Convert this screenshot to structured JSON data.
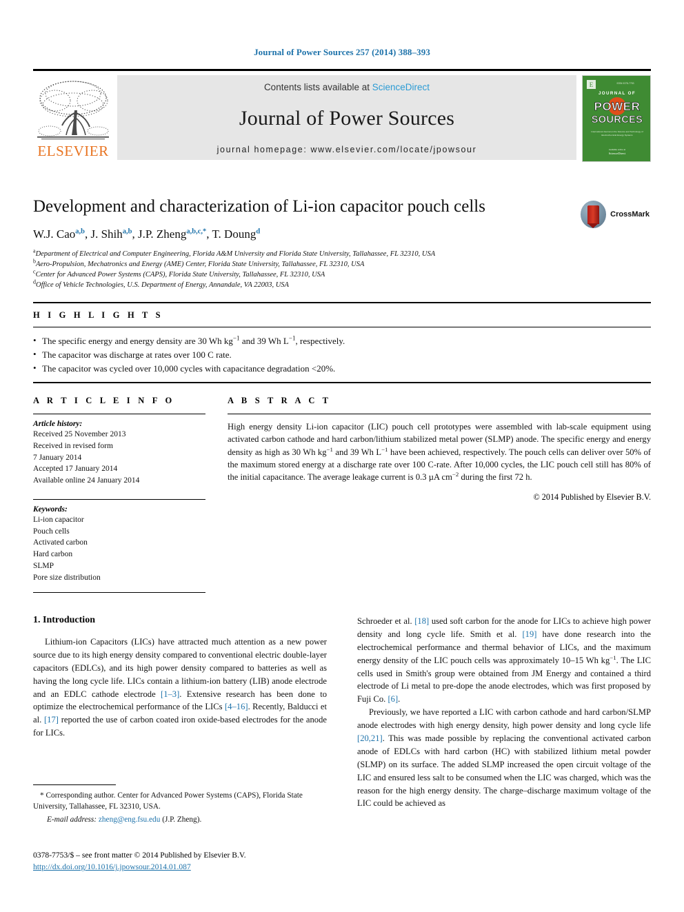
{
  "running_head": "Journal of Power Sources 257 (2014) 388–393",
  "masthead": {
    "publisher_name": "ELSEVIER",
    "publisher_logo_alt": "elsevier-tree-logo",
    "contents_prefix": "Contents lists available at ",
    "contents_link": "ScienceDirect",
    "journal_name": "Journal of Power Sources",
    "homepage": "journal homepage: www.elsevier.com/locate/jpowsour",
    "cover": {
      "line1": "JOURNAL OF",
      "line2": "POWER",
      "line3": "SOURCES",
      "tagline": "International Journal on the Science and Technology of Electrochemical Energy Systems",
      "footer": "Available online at ScienceDirect",
      "bg_color": "#3f8b33",
      "accent_color": "#e04e1b"
    }
  },
  "article": {
    "title": "Development and characterization of Li-ion capacitor pouch cells",
    "authors": [
      {
        "name": "W.J. Cao",
        "marks": "a,b"
      },
      {
        "name": "J. Shih",
        "marks": "a,b"
      },
      {
        "name": "J.P. Zheng",
        "marks": "a,b,c,*"
      },
      {
        "name": "T. Doung",
        "marks": "d"
      }
    ],
    "affiliations": [
      {
        "mark": "a",
        "text": "Department of Electrical and Computer Engineering, Florida A&M University and Florida State University, Tallahassee, FL 32310, USA"
      },
      {
        "mark": "b",
        "text": "Aero-Propulsion, Mechatronics and Energy (AME) Center, Florida State University, Tallahassee, FL 32310, USA"
      },
      {
        "mark": "c",
        "text": "Center for Advanced Power Systems (CAPS), Florida State University, Tallahassee, FL 32310, USA"
      },
      {
        "mark": "d",
        "text": "Office of Vehicle Technologies, U.S. Department of Energy, Annandale, VA 22003, USA"
      }
    ],
    "crossmark_label": "CrossMark"
  },
  "highlights": {
    "label": "H I G H L I G H T S",
    "items": [
      "The specific energy and energy density are 30 Wh kg−1 and 39 Wh L−1, respectively.",
      "The capacitor was discharge at rates over 100 C rate.",
      "The capacitor was cycled over 10,000 cycles with capacitance degradation <20%."
    ]
  },
  "article_info": {
    "label": "A R T I C L E  I N F O",
    "history_title": "Article history:",
    "history": [
      "Received 25 November 2013",
      "Received in revised form",
      "7 January 2014",
      "Accepted 17 January 2014",
      "Available online 24 January 2014"
    ],
    "keywords_title": "Keywords:",
    "keywords": [
      "Li-ion capacitor",
      "Pouch cells",
      "Activated carbon",
      "Hard carbon",
      "SLMP",
      "Pore size distribution"
    ]
  },
  "abstract": {
    "label": "A B S T R A C T",
    "text": "High energy density Li-ion capacitor (LIC) pouch cell prototypes were assembled with lab-scale equipment using activated carbon cathode and hard carbon/lithium stabilized metal power (SLMP) anode. The specific energy and energy density as high as 30 Wh kg−1 and 39 Wh L−1 have been achieved, respectively. The pouch cells can deliver over 50% of the maximum stored energy at a discharge rate over 100 C-rate. After 10,000 cycles, the LIC pouch cell still has 80% of the initial capacitance. The average leakage current is 0.3 µA cm−2 during the first 72 h.",
    "copyright": "© 2014 Published by Elsevier B.V."
  },
  "body": {
    "section_heading": "1.  Introduction",
    "left_paragraphs": [
      "Lithium-ion Capacitors (LICs) have attracted much attention as a new power source due to its high energy density compared to conventional electric double-layer capacitors (EDLCs), and its high power density compared to batteries as well as having the long cycle life. LICs contain a lithium-ion battery (LIB) anode electrode and an EDLC cathode electrode [1–3]. Extensive research has been done to optimize the electrochemical performance of the LICs [4–16]. Recently, Balducci et al. [17] reported the use of carbon coated iron oxide-based electrodes for the anode for LICs."
    ],
    "right_paragraphs": [
      "Schroeder et al. [18] used soft carbon for the anode for LICs to achieve high power density and long cycle life. Smith et al. [19] have done research into the electrochemical performance and thermal behavior of LICs, and the maximum energy density of the LIC pouch cells was approximately 10–15 Wh kg−1. The LIC cells used in Smith's group were obtained from JM Energy and contained a third electrode of Li metal to pre-dope the anode electrodes, which was first proposed by Fuji Co. [6].",
      "Previously, we have reported a LIC with carbon cathode and hard carbon/SLMP anode electrodes with high energy density, high power density and long cycle life [20,21]. This was made possible by replacing the conventional activated carbon anode of EDLCs with hard carbon (HC) with stabilized lithium metal powder (SLMP) on its surface. The added SLMP increased the open circuit voltage of the LIC and ensured less salt to be consumed when the LIC was charged, which was the reason for the high energy density. The charge–discharge maximum voltage of the LIC could be achieved as"
    ]
  },
  "footnote": {
    "corresponding": "* Corresponding author. Center for Advanced Power Systems (CAPS), Florida State University, Tallahassee, FL 32310, USA.",
    "email_label": "E-mail address:",
    "email": "zheng@eng.fsu.edu",
    "email_owner": "(J.P. Zheng)."
  },
  "colophon": {
    "issn_line": "0378-7753/$ – see front matter © 2014 Published by Elsevier B.V.",
    "doi": "http://dx.doi.org/10.1016/j.jpowsour.2014.01.087"
  }
}
